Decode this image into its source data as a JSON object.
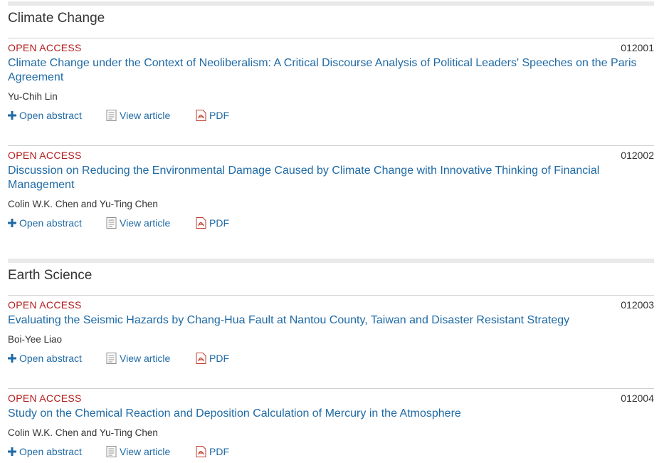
{
  "colors": {
    "accent": "#1f6aa5",
    "open_access": "#b31b1b",
    "divider": "#cfcfcf",
    "section_bar": "#e9e9e9"
  },
  "icons": {
    "open_abstract": "plus-icon",
    "view_article": "document-icon",
    "pdf": "pdf-icon"
  },
  "sections": [
    {
      "title": "Climate Change",
      "articles": [
        {
          "badge": "OPEN ACCESS",
          "id": "012001",
          "title": "Climate Change under the Context of Neoliberalism: A Critical Discourse Analysis of Political Leaders' Speeches on the Paris Agreement",
          "authors": "Yu-Chih Lin",
          "actions": {
            "abstract": "Open abstract",
            "view": "View article",
            "pdf": "PDF"
          }
        },
        {
          "badge": "OPEN ACCESS",
          "id": "012002",
          "title": "Discussion on Reducing the Environmental Damage Caused by Climate Change with Innovative Thinking of Financial Management",
          "authors": "Colin W.K. Chen and Yu-Ting Chen",
          "actions": {
            "abstract": "Open abstract",
            "view": "View article",
            "pdf": "PDF"
          }
        }
      ]
    },
    {
      "title": "Earth Science",
      "articles": [
        {
          "badge": "OPEN ACCESS",
          "id": "012003",
          "title": "Evaluating the Seismic Hazards by Chang-Hua Fault at Nantou County, Taiwan and Disaster Resistant Strategy",
          "authors": "Boi-Yee Liao",
          "actions": {
            "abstract": "Open abstract",
            "view": "View article",
            "pdf": "PDF"
          }
        },
        {
          "badge": "OPEN ACCESS",
          "id": "012004",
          "title": "Study on the Chemical Reaction and Deposition Calculation of Mercury in the Atmosphere",
          "authors": "Colin W.K. Chen and Yu-Ting Chen",
          "actions": {
            "abstract": "Open abstract",
            "view": "View article",
            "pdf": "PDF"
          }
        }
      ]
    }
  ]
}
